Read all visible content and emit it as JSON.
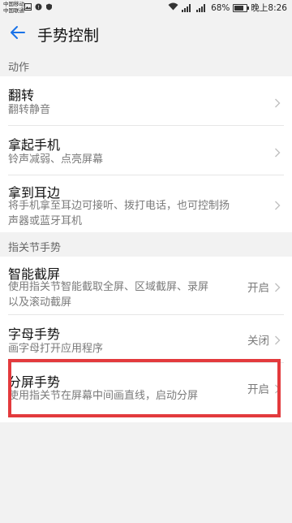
{
  "status_bar": {
    "carrier_1": "中国移动",
    "carrier_2": "中国联通",
    "network_1": "4G",
    "network_2": "4G",
    "battery": "68%",
    "time": "晚上8:26",
    "icons": [
      "image-icon",
      "notification-icon",
      "shield-icon",
      "wifi-icon",
      "signal-icon",
      "signal-icon",
      "battery-icon"
    ]
  },
  "header": {
    "title": "手势控制",
    "back_icon": "arrow-left-icon"
  },
  "sections": {
    "actions_header": "动作",
    "knuckle_header": "指关节手势"
  },
  "items": {
    "flip": {
      "title": "翻转",
      "subtitle": "翻转静音"
    },
    "pickup": {
      "title": "拿起手机",
      "subtitle": "铃声减弱、点亮屏幕"
    },
    "ear": {
      "title": "拿到耳边",
      "subtitle_line1": "将手机拿至耳边可接听、拨打电话，也可控制扬",
      "subtitle_line2": "声器或蓝牙耳机"
    },
    "smart_screenshot": {
      "title": "智能截屏",
      "subtitle_line1": "使用指关节智能截取全屏、区域截屏、录屏",
      "subtitle_line2": "以及滚动截屏",
      "value": "开启"
    },
    "letter_gesture": {
      "title": "字母手势",
      "subtitle": "画字母打开应用程序",
      "value": "关闭"
    },
    "split_screen": {
      "title": "分屏手势",
      "subtitle": "使用指关节在屏幕中间画直线，启动分屏",
      "value": "开启"
    }
  },
  "colors": {
    "accent": "#1a73e8",
    "highlight": "#e33a3d",
    "background": "#f2f2f2",
    "card": "#ffffff"
  }
}
